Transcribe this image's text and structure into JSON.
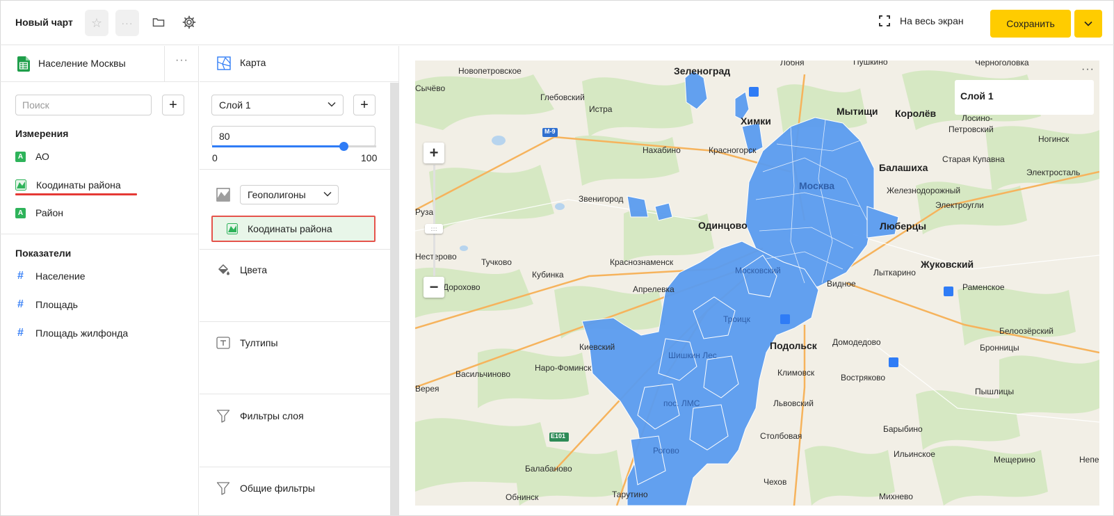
{
  "header": {
    "title": "Новый чарт",
    "star_icon": "star-icon",
    "more_icon": "more-icon",
    "fullscreen_label": "На весь экран",
    "save_label": "Сохранить"
  },
  "dataset": {
    "name": "Население Москвы",
    "search_placeholder": "Поиск",
    "dimensions_title": "Измерения",
    "dimensions": [
      {
        "label": "АО",
        "type": "string"
      },
      {
        "label": "Коодинаты района",
        "type": "geopolygon"
      },
      {
        "label": "Район",
        "type": "string"
      }
    ],
    "measures_title": "Показатели",
    "measures": [
      {
        "label": "Население"
      },
      {
        "label": "Площадь"
      },
      {
        "label": "Площадь жилфонда"
      }
    ]
  },
  "visualization": {
    "type_label": "Карта",
    "layer_name": "Слой 1",
    "opacity_value": "80",
    "opacity_fraction": 0.8,
    "range_min": "0",
    "range_max": "100",
    "geotype_label": "Геополигоны",
    "geo_field": "Коодинаты района",
    "colors_label": "Цвета",
    "tooltips_label": "Тултипы",
    "layer_filters_label": "Фильтры слоя",
    "common_filters_label": "Общие фильтры"
  },
  "map": {
    "legend_title": "Слой 1",
    "polygon_color": "#5b9cf0",
    "road_badges": [
      "М-9",
      "E101"
    ],
    "labels": [
      {
        "text": "Новопетровское"
      },
      {
        "text": "Сычёво"
      },
      {
        "text": "Глебовский"
      },
      {
        "text": "Истра"
      },
      {
        "text": "Зеленоград",
        "big": true
      },
      {
        "text": "Лобня"
      },
      {
        "text": "Пушкино"
      },
      {
        "text": "Черноголовка"
      },
      {
        "text": "Мытищи",
        "big": true
      },
      {
        "text": "Королёв",
        "big": true
      },
      {
        "text": "Химки",
        "big": true
      },
      {
        "text": "Лосино-"
      },
      {
        "text": "Петровский"
      },
      {
        "text": "Ногинск"
      },
      {
        "text": "Нахабино"
      },
      {
        "text": "Красногорск"
      },
      {
        "text": "Старая Купавна"
      },
      {
        "text": "Балашиха",
        "big": true
      },
      {
        "text": "Электросталь"
      },
      {
        "text": "Москва",
        "big": true
      },
      {
        "text": "Железнодорожный"
      },
      {
        "text": "Звенигород"
      },
      {
        "text": "Электроугли"
      },
      {
        "text": "Руза"
      },
      {
        "text": "Одинцово",
        "big": true
      },
      {
        "text": "Люберцы",
        "big": true
      },
      {
        "text": "Нестерово"
      },
      {
        "text": "Тучково"
      },
      {
        "text": "Краснознаменск"
      },
      {
        "text": "Московский"
      },
      {
        "text": "Жуковский",
        "big": true
      },
      {
        "text": "Кубинка"
      },
      {
        "text": "Лыткарино"
      },
      {
        "text": "Дорохово"
      },
      {
        "text": "Апрелевка"
      },
      {
        "text": "Видное"
      },
      {
        "text": "Раменское"
      },
      {
        "text": "Троицк"
      },
      {
        "text": "Белоозёрский"
      },
      {
        "text": "Киевский"
      },
      {
        "text": "Подольск",
        "big": true
      },
      {
        "text": "Домодедово"
      },
      {
        "text": "Бронницы"
      },
      {
        "text": "Наро-Фоминск"
      },
      {
        "text": "Шишкин Лес"
      },
      {
        "text": "Климовск"
      },
      {
        "text": "Васильчиново"
      },
      {
        "text": "Вострякoво"
      },
      {
        "text": "Верея"
      },
      {
        "text": "пос. ЛМС"
      },
      {
        "text": "Львовский"
      },
      {
        "text": "Пышлицы"
      },
      {
        "text": "Столбовая"
      },
      {
        "text": "Барыбино"
      },
      {
        "text": "Ильинское"
      },
      {
        "text": "Рогово"
      },
      {
        "text": "Балабаново"
      },
      {
        "text": "Мещерино"
      },
      {
        "text": "Непе"
      },
      {
        "text": "Чехов"
      },
      {
        "text": "Обнинск"
      },
      {
        "text": "Тарутино"
      },
      {
        "text": "Михнево"
      }
    ]
  }
}
